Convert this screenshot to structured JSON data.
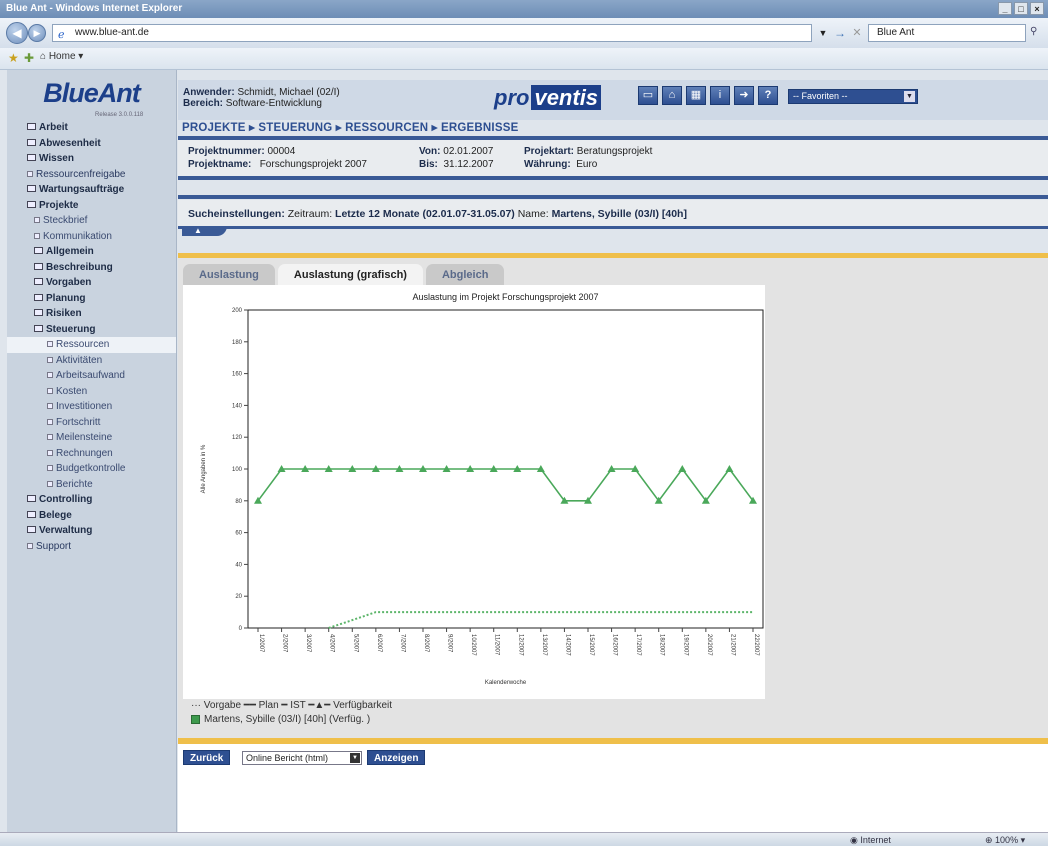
{
  "browser": {
    "window_title": "Blue Ant - Windows Internet Explorer",
    "url": "www.blue-ant.de",
    "search_text": "Blue Ant",
    "home_tab": "Home",
    "status_zone": "Internet",
    "status_zoom": "100%"
  },
  "app": {
    "logo": "BlueAnt",
    "release": "Release 3.0.0.118",
    "user_label": "Anwender:",
    "user_value": "Schmidt, Michael (02/I)",
    "area_label": "Bereich:",
    "area_value": "Software-Entwicklung",
    "brand_prefix": "pro",
    "brand_suffix": "ventis",
    "favorites": "-- Favoriten --",
    "toolbar_icons": [
      "notes-icon",
      "home-icon",
      "calendar-icon",
      "info-icon",
      "forward-icon",
      "help-icon"
    ]
  },
  "breadcrumb": "PROJEKTE ▸ STEUERUNG ▸ RESSOURCEN ▸ ERGEBNISSE",
  "project": {
    "nummer_label": "Projektnummer:",
    "nummer_value": "00004",
    "name_label": "Projektname:",
    "name_value": "Forschungsprojekt 2007",
    "von_label": "Von:",
    "von_value": "02.01.2007",
    "bis_label": "Bis:",
    "bis_value": "31.12.2007",
    "art_label": "Projektart:",
    "art_value": "Beratungsprojekt",
    "waehrung_label": "Währung:",
    "waehrung_value": "Euro"
  },
  "search": {
    "label": "Sucheinstellungen:",
    "zeitraum_label": "Zeitraum:",
    "zeitraum_value": "Letzte 12 Monate (02.01.07-31.05.07)",
    "name_label": "Name:",
    "name_value": "Martens, Sybille (03/I) [40h]"
  },
  "sidebar": {
    "items": [
      {
        "label": "Arbeit",
        "style": "lvl0"
      },
      {
        "label": "Abwesenheit",
        "style": "lvl0"
      },
      {
        "label": "Wissen",
        "style": "lvl0"
      },
      {
        "label": "Ressourcenfreigabe",
        "style": "lvl0s"
      },
      {
        "label": "Wartungsaufträge",
        "style": "lvl0"
      },
      {
        "label": "Projekte",
        "style": "lvl0"
      },
      {
        "label": "Steckbrief",
        "style": "lvl1"
      },
      {
        "label": "Kommunikation",
        "style": "lvl1"
      },
      {
        "label": "Allgemein",
        "style": "lvl1b"
      },
      {
        "label": "Beschreibung",
        "style": "lvl1b"
      },
      {
        "label": "Vorgaben",
        "style": "lvl1b"
      },
      {
        "label": "Planung",
        "style": "lvl1b"
      },
      {
        "label": "Risiken",
        "style": "lvl1b"
      },
      {
        "label": "Steuerung",
        "style": "lvl1b"
      },
      {
        "label": "Ressourcen",
        "style": "lvl2",
        "active": true
      },
      {
        "label": "Aktivitäten",
        "style": "lvl2"
      },
      {
        "label": "Arbeitsaufwand",
        "style": "lvl2"
      },
      {
        "label": "Kosten",
        "style": "lvl2"
      },
      {
        "label": "Investitionen",
        "style": "lvl2"
      },
      {
        "label": "Fortschritt",
        "style": "lvl2"
      },
      {
        "label": "Meilensteine",
        "style": "lvl2"
      },
      {
        "label": "Rechnungen",
        "style": "lvl2"
      },
      {
        "label": "Budgetkontrolle",
        "style": "lvl2"
      },
      {
        "label": "Berichte",
        "style": "lvl2"
      },
      {
        "label": "Controlling",
        "style": "lvl0"
      },
      {
        "label": "Belege",
        "style": "lvl0"
      },
      {
        "label": "Verwaltung",
        "style": "lvl0"
      },
      {
        "label": "Support",
        "style": "lvl0s"
      }
    ]
  },
  "tabs": [
    "Auslastung",
    "Auslastung (grafisch)",
    "Abgleich"
  ],
  "active_tab": 1,
  "legend": {
    "line1": "··· Vorgabe  ━━ Plan  ━ IST  ━▲━ Verfügbarkeit",
    "line2": "Martens, Sybille (03/I) [40h] (Verfüg. )"
  },
  "buttons": {
    "back": "Zurück",
    "report": "Online Bericht (html)",
    "show": "Anzeigen"
  },
  "chart_data": {
    "type": "line",
    "title": "Auslastung im Projekt Forschungsprojekt 2007",
    "xlabel": "Kalenderwoche",
    "ylabel": "Alle Angaben in %",
    "ylim": [
      0,
      200
    ],
    "yticks": [
      0,
      20,
      40,
      60,
      80,
      100,
      120,
      140,
      160,
      180,
      200
    ],
    "categories": [
      "1/2007",
      "2/2007",
      "3/2007",
      "4/2007",
      "5/2007",
      "6/2007",
      "7/2007",
      "8/2007",
      "9/2007",
      "10/2007",
      "11/2007",
      "12/2007",
      "13/2007",
      "14/2007",
      "15/2007",
      "16/2007",
      "17/2007",
      "18/2007",
      "19/2007",
      "20/2007",
      "21/2007",
      "22/2007"
    ],
    "series": [
      {
        "name": "Verfügbarkeit",
        "color": "#4aa85a",
        "style": "line-triangle",
        "values": [
          80,
          100,
          100,
          100,
          100,
          100,
          100,
          100,
          100,
          100,
          100,
          100,
          100,
          80,
          80,
          100,
          100,
          80,
          100,
          80,
          100,
          80
        ]
      },
      {
        "name": "Vorgabe",
        "color": "#5cb56a",
        "style": "dotted",
        "values": [
          null,
          null,
          null,
          0,
          5,
          10,
          10,
          10,
          10,
          10,
          10,
          10,
          10,
          10,
          10,
          10,
          10,
          10,
          10,
          10,
          10,
          10
        ]
      }
    ]
  }
}
